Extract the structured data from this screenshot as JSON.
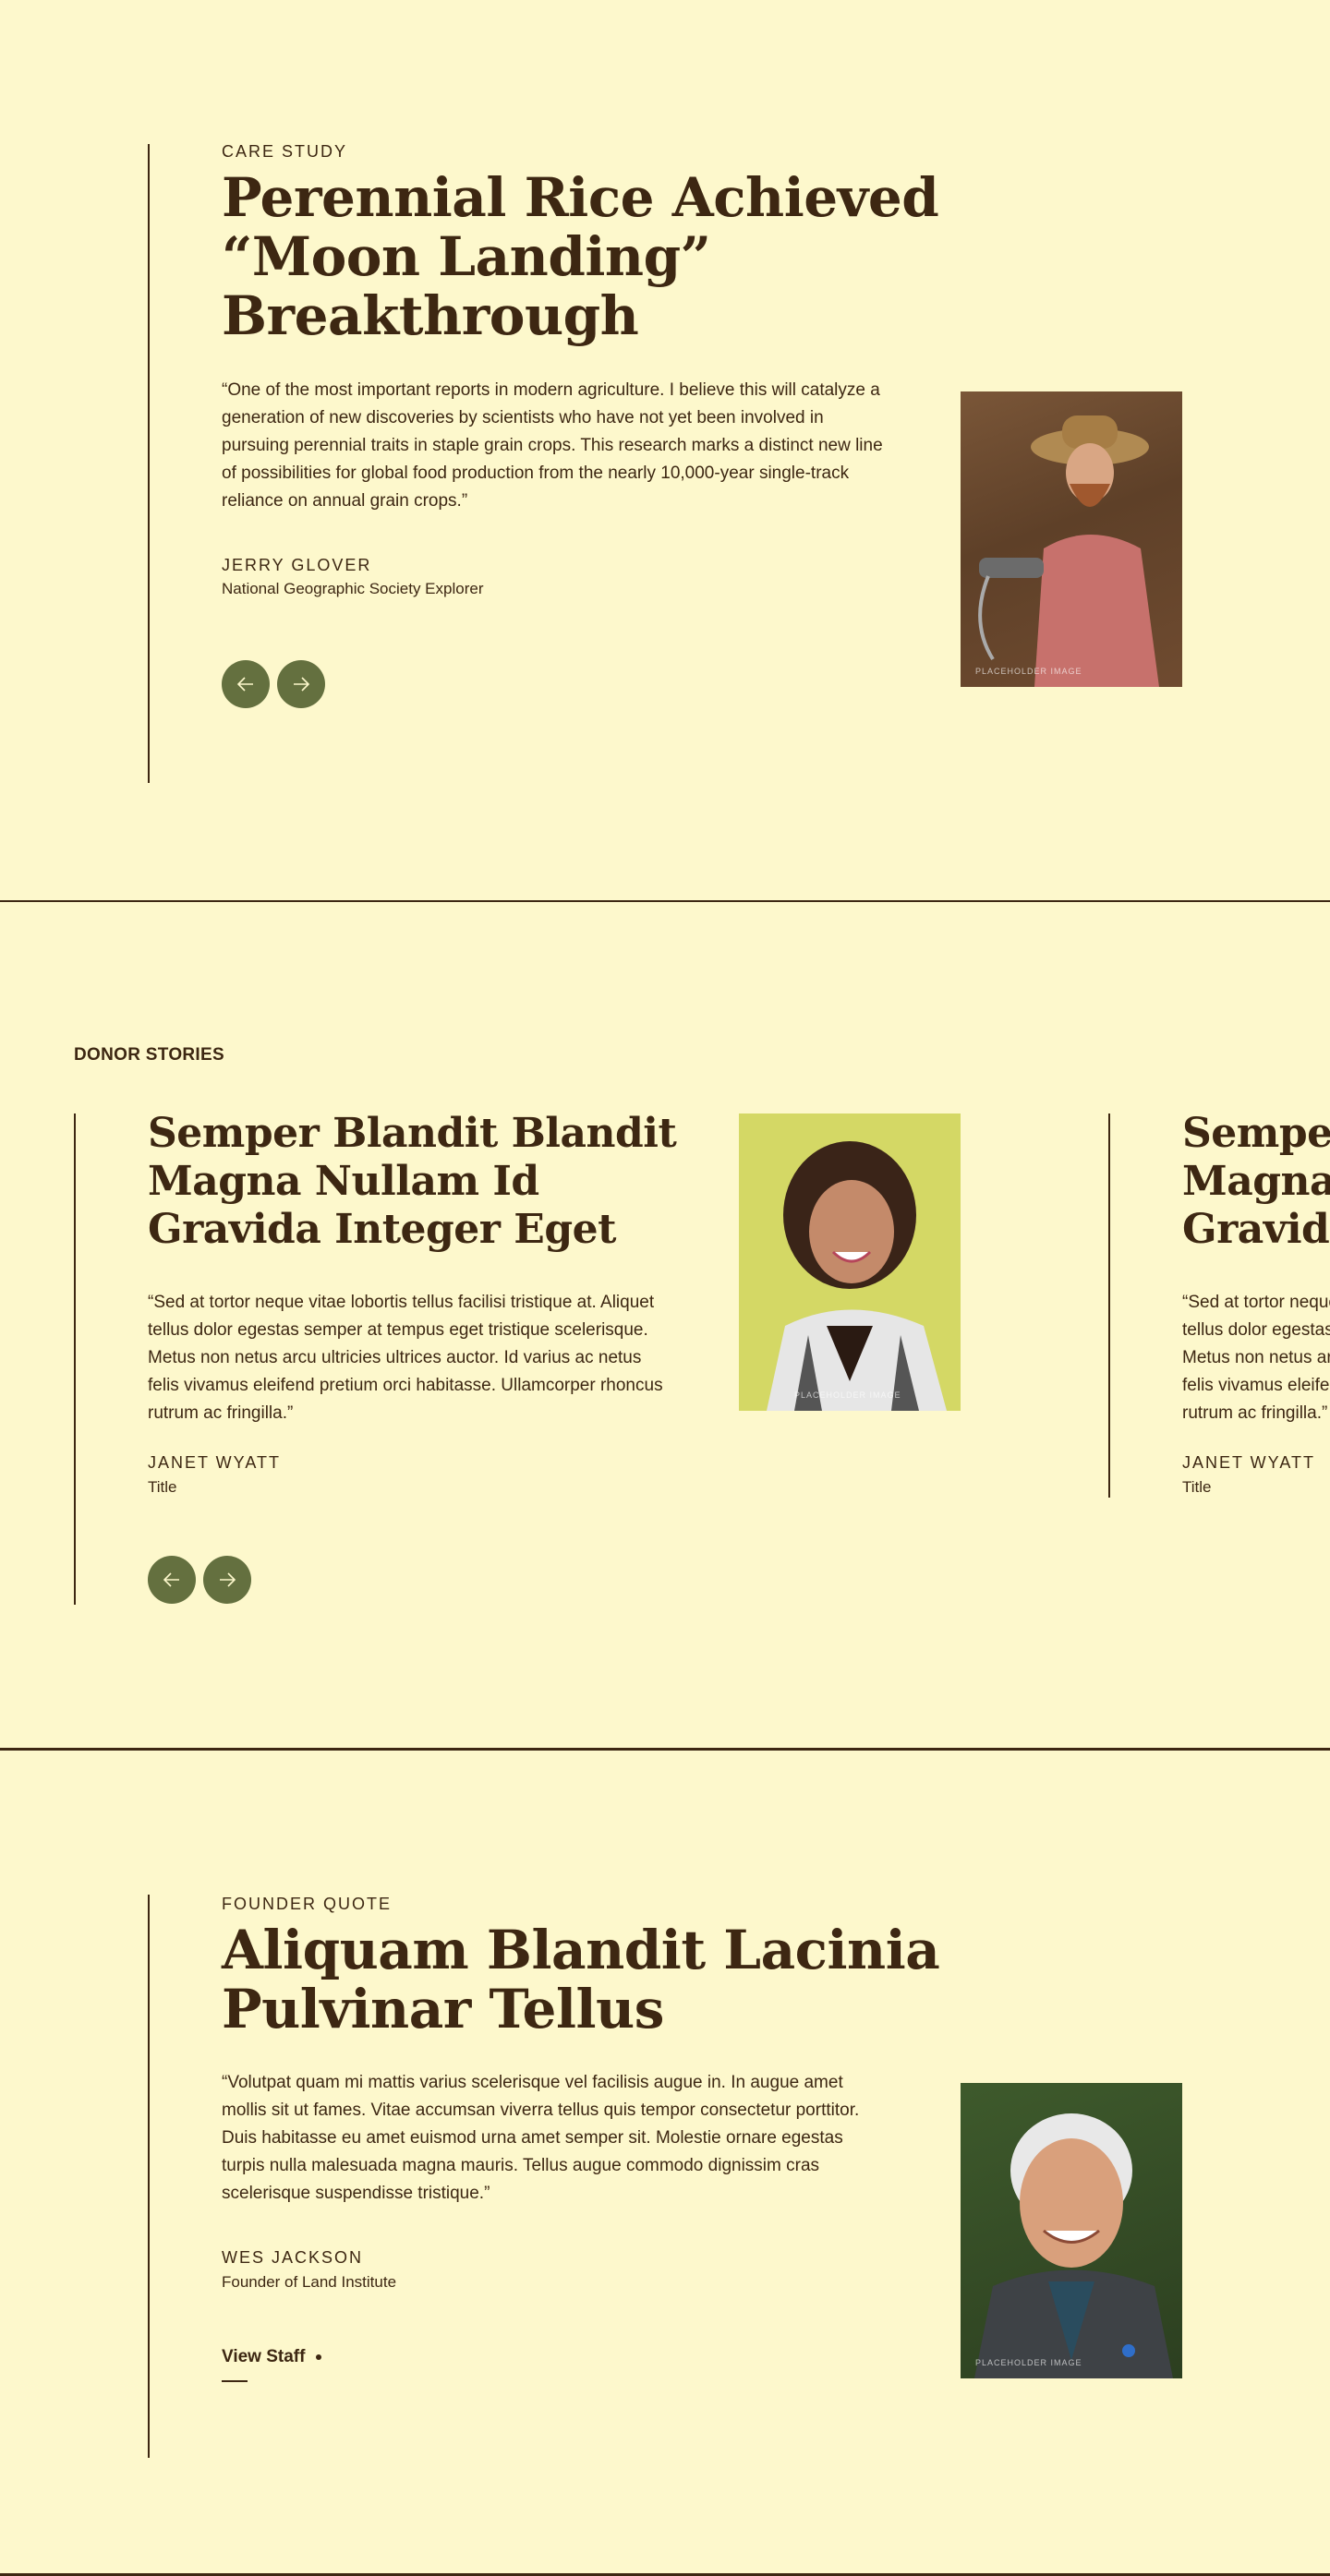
{
  "case_study": {
    "eyebrow": "CARE STUDY",
    "title_line1": "Perennial Rice Achieved",
    "title_line2": "“Moon Landing”",
    "title_line3": "Breakthrough",
    "quote": "“One of the most important reports in modern agriculture. I believe this will catalyze a generation of new discoveries by scientists who have not yet been involved in pursuing perennial traits in staple grain crops. This research marks a distinct new line of possibilities for global food production from the nearly 10,000-year single-track reliance on annual grain crops.”",
    "name": "JERRY GLOVER",
    "role": "National Geographic Society Explorer",
    "photo_label": "PLACEHOLDER IMAGE"
  },
  "donor_stories": {
    "heading": "DONOR STORIES",
    "card": {
      "title_line1": "Semper Blandit Blandit",
      "title_line2": "Magna Nullam Id",
      "title_line3": "Gravida Integer Eget",
      "quote": "“Sed at tortor neque vitae lobortis tellus facilisi tristique at. Aliquet tellus dolor egestas semper at tempus eget tristique scelerisque. Metus non netus arcu ultricies ultrices auctor. Id varius ac netus felis vivamus eleifend pretium orci habitasse. Ullamcorper rhoncus rutrum ac fringilla.”",
      "name": "JANET WYATT",
      "role": "Title",
      "photo_label": "PLACEHOLDER IMAGE"
    },
    "next_card": {
      "title_line1": "Semper Blandit Blandit",
      "title_line2": "Magna Nullam Id",
      "title_line3": "Gravida Integer Eget",
      "quote": "“Sed at tortor neque vitae lobortis tellus facilisi tristique at. Aliquet tellus dolor egestas semper at tempus eget tristique scelerisque. Metus non netus arcu ultricies ultrices auctor. Id varius ac netus felis vivamus eleifend pretium orci habitasse. Ullamcorper rhoncus rutrum ac fringilla.”",
      "name": "JANET WYATT",
      "role": "Title"
    }
  },
  "founder": {
    "eyebrow": "FOUNDER QUOTE",
    "title_line1": "Aliquam Blandit Lacinia",
    "title_line2": "Pulvinar Tellus",
    "quote": "“Volutpat quam mi mattis varius scelerisque vel facilisis augue in. In augue amet mollis sit ut fames. Vitae accumsan viverra tellus quis tempor consectetur porttitor. Duis habitasse eu amet euismod urna amet semper sit. Molestie ornare egestas turpis nulla malesuada magna mauris. Tellus augue commodo dignissim cras scelerisque suspendisse tristique.”",
    "name": "WES JACKSON",
    "role": "Founder of Land Institute",
    "link_label": "View Staff",
    "photo_label": "PLACEHOLDER IMAGE"
  },
  "colors": {
    "background": "#fdf8cc",
    "text": "#3d2712",
    "accent_green": "#64703f"
  },
  "icons": [
    "arrow-left-icon",
    "arrow-right-icon",
    "bullet-dot-icon"
  ]
}
